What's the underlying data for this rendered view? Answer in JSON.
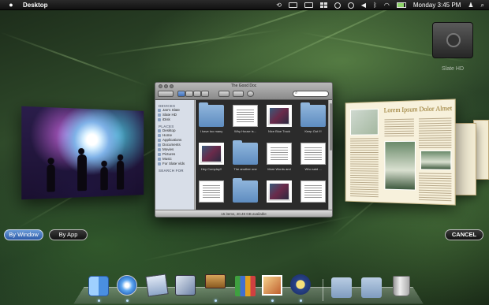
{
  "menubar": {
    "app_name": "Desktop",
    "clock": "Monday 3:45 PM"
  },
  "desktop": {
    "hd_label": "Slate HD"
  },
  "finder": {
    "title": "The Good Doc",
    "sidebar": {
      "devices_header": "DEVICES",
      "devices": [
        "Jan's Slate",
        "Slate HD",
        "iDisk"
      ],
      "places_header": "PLACES",
      "places": [
        "Desktop",
        "Home",
        "Applications",
        "Documents",
        "Movies",
        "Pictures",
        "Music",
        "For Slate Vids"
      ],
      "search_header": "SEARCH FOR"
    },
    "files": [
      "I have too many",
      "Why House is...",
      "Nice Blue Truck",
      "Keep Out !!!",
      "Hey Complay!!",
      "The another one",
      "More Words and",
      "Who said ...",
      "",
      "",
      "",
      ""
    ],
    "status": "15 items, 40.49 GB available"
  },
  "brochure": {
    "title": "Lorem Ipsum Dolor Almet"
  },
  "buttons": {
    "by_window": "By Window",
    "by_app": "By App",
    "cancel": "CANCEL"
  },
  "dock": {
    "items": [
      "Finder",
      "Safari",
      "Mail",
      "Preview",
      "Keynote",
      "Numbers",
      "iPhoto",
      "iMovie",
      "Applications",
      "Downloads",
      "Trash"
    ]
  }
}
